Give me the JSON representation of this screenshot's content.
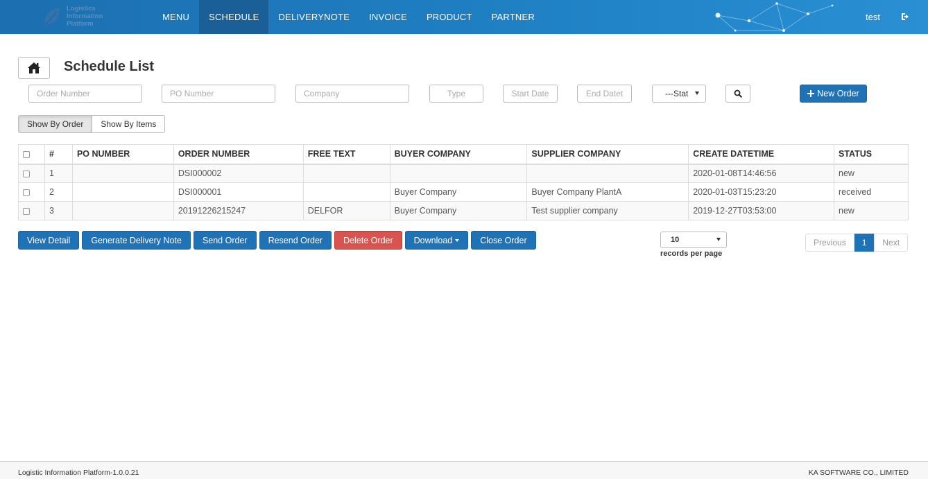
{
  "logo": {
    "lines": [
      "Logistics",
      "Information",
      "Platform"
    ]
  },
  "nav": {
    "items": [
      "MENU",
      "SCHEDULE",
      "DELIVERYNOTE",
      "INVOICE",
      "PRODUCT",
      "PARTNER"
    ],
    "active": "SCHEDULE",
    "user": "test"
  },
  "page": {
    "title": "Schedule List"
  },
  "filters": {
    "order_number": "Order Number",
    "po_number": "PO Number",
    "company": "Company",
    "type": "Type",
    "start_date": "Start Date",
    "end_date": "End Datet",
    "status": "---Stat",
    "new_order": "New Order"
  },
  "view_toggle": {
    "by_order": "Show By Order",
    "by_items": "Show By Items"
  },
  "table": {
    "headers": [
      "#",
      "PO NUMBER",
      "ORDER NUMBER",
      "FREE TEXT",
      "BUYER COMPANY",
      "SUPPLIER COMPANY",
      "CREATE DATETIME",
      "STATUS"
    ],
    "rows": [
      [
        "1",
        "",
        "DSI000002",
        "",
        "",
        "",
        "2020-01-08T14:46:56",
        "new"
      ],
      [
        "2",
        "",
        "DSI000001",
        "",
        "Buyer Company",
        "Buyer Company PlantA",
        "2020-01-03T15:23:20",
        "received"
      ],
      [
        "3",
        "",
        "20191226215247",
        "DELFOR",
        "Buyer Company",
        "Test supplier company",
        "2019-12-27T03:53:00",
        "new"
      ]
    ]
  },
  "actions": {
    "view_detail": "View Detail",
    "generate_delivery_note": "Generate Delivery Note",
    "send_order": "Send Order",
    "resend_order": "Resend Order",
    "delete_order": "Delete Order",
    "download": "Download",
    "close_order": "Close Order"
  },
  "paging": {
    "records_value": "10",
    "records_label": "records per page",
    "previous": "Previous",
    "current": "1",
    "next": "Next"
  },
  "footer": {
    "left": "Logistic Information Platform-1.0.0.21",
    "right": "KA SOFTWARE CO., LIMITED"
  },
  "colors": {
    "primary": "#1f72b5",
    "danger": "#d9534f",
    "nav_active": "#1a5f97"
  }
}
